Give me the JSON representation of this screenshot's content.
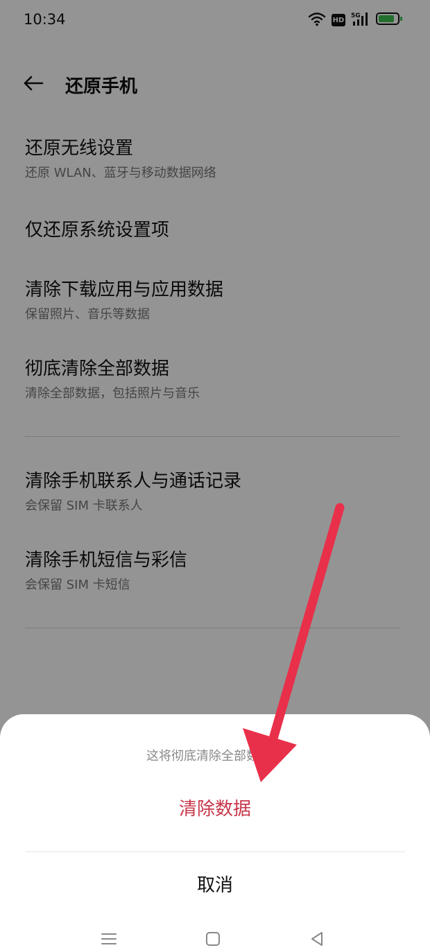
{
  "status_bar": {
    "time": "10:34",
    "icons": [
      "wifi-icon",
      "hd-badge",
      "5g-signal-icon",
      "battery-icon"
    ],
    "hd_label": "HD",
    "network_label": "5G",
    "battery_color": "#3fbf4f"
  },
  "header": {
    "back_icon": "arrow-left-icon",
    "title": "还原手机"
  },
  "options": [
    {
      "title": "还原无线设置",
      "subtitle": "还原 WLAN、蓝牙与移动数据网络"
    },
    {
      "title": "仅还原系统设置项",
      "subtitle": ""
    },
    {
      "title": "清除下载应用与应用数据",
      "subtitle": "保留照片、音乐等数据"
    },
    {
      "title": "彻底清除全部数据",
      "subtitle": "清除全部数据，包括照片与音乐"
    },
    {
      "title": "清除手机联系人与通话记录",
      "subtitle": "会保留 SIM 卡联系人"
    },
    {
      "title": "清除手机短信与彩信",
      "subtitle": "会保留 SIM 卡短信"
    }
  ],
  "dialog": {
    "message": "这将彻底清除全部数据。",
    "confirm_label": "清除数据",
    "cancel_label": "取消",
    "confirm_color": "#c8364a"
  },
  "nav_bar": {
    "icons": [
      "menu-icon",
      "home-square-icon",
      "back-triangle-icon"
    ]
  },
  "annotation": {
    "arrow_color": "#e8304a"
  }
}
